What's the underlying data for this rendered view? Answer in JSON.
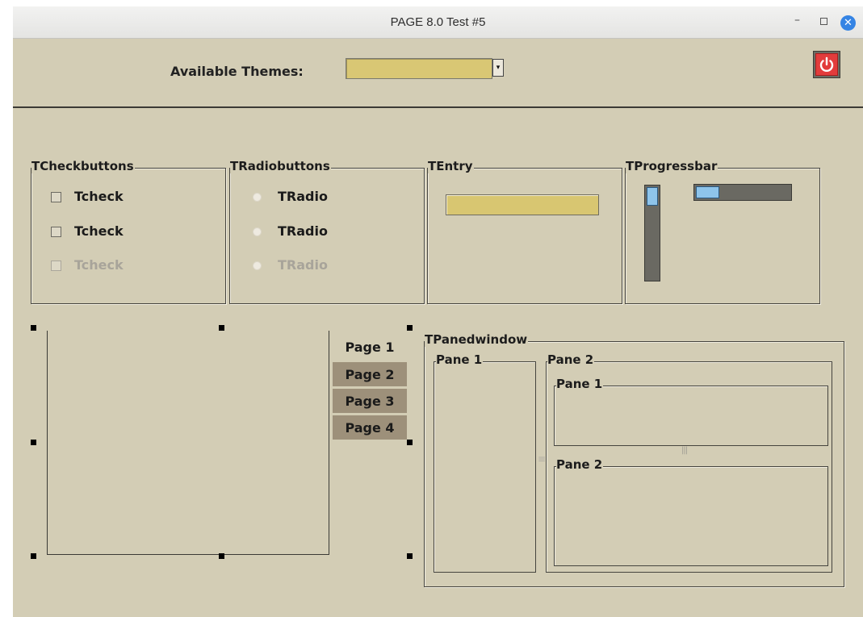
{
  "window": {
    "title": "PAGE 8.0 Test #5",
    "controls": {
      "minimize": "–",
      "maximize": "□",
      "close": "✕"
    }
  },
  "toolbar": {
    "themes_label": "Available Themes:",
    "themes_value": "",
    "themes_arrow": "▾",
    "quit_icon": "power-icon"
  },
  "checkbuttons": {
    "title": "TCheckbuttons",
    "items": [
      {
        "label": "Tcheck",
        "checked": false,
        "enabled": true
      },
      {
        "label": "Tcheck",
        "checked": false,
        "enabled": true
      },
      {
        "label": "Tcheck",
        "checked": false,
        "enabled": false
      }
    ]
  },
  "radiobuttons": {
    "title": "TRadiobuttons",
    "items": [
      {
        "label": "TRadio",
        "selected": false,
        "enabled": true
      },
      {
        "label": "TRadio",
        "selected": false,
        "enabled": true
      },
      {
        "label": "TRadio",
        "selected": false,
        "enabled": false
      }
    ]
  },
  "entry": {
    "title": "TEntry",
    "value": ""
  },
  "progressbars": {
    "title": "TProgressbar",
    "vertical_value": 0.2,
    "horizontal_value": 0.25
  },
  "notebook": {
    "tabs": [
      {
        "label": "Page 1",
        "active": true
      },
      {
        "label": "Page 2",
        "active": false
      },
      {
        "label": "Page 3",
        "active": false
      },
      {
        "label": "Page 4",
        "active": false
      }
    ]
  },
  "panedwindow": {
    "title": "TPanedwindow",
    "pane1_label": "Pane 1",
    "pane2_label": "Pane 2",
    "inner_pane1_label": "Pane 1",
    "inner_pane2_label": "Pane 2",
    "sash_grip": "|||",
    "sash_grip_vertical": "≡"
  },
  "colors": {
    "background": "#d3cdb5",
    "field": "#d8c671",
    "inactive_tab": "#9d907a",
    "progress_fill": "#8ec4ea",
    "quit_button": "#e23c3c"
  }
}
